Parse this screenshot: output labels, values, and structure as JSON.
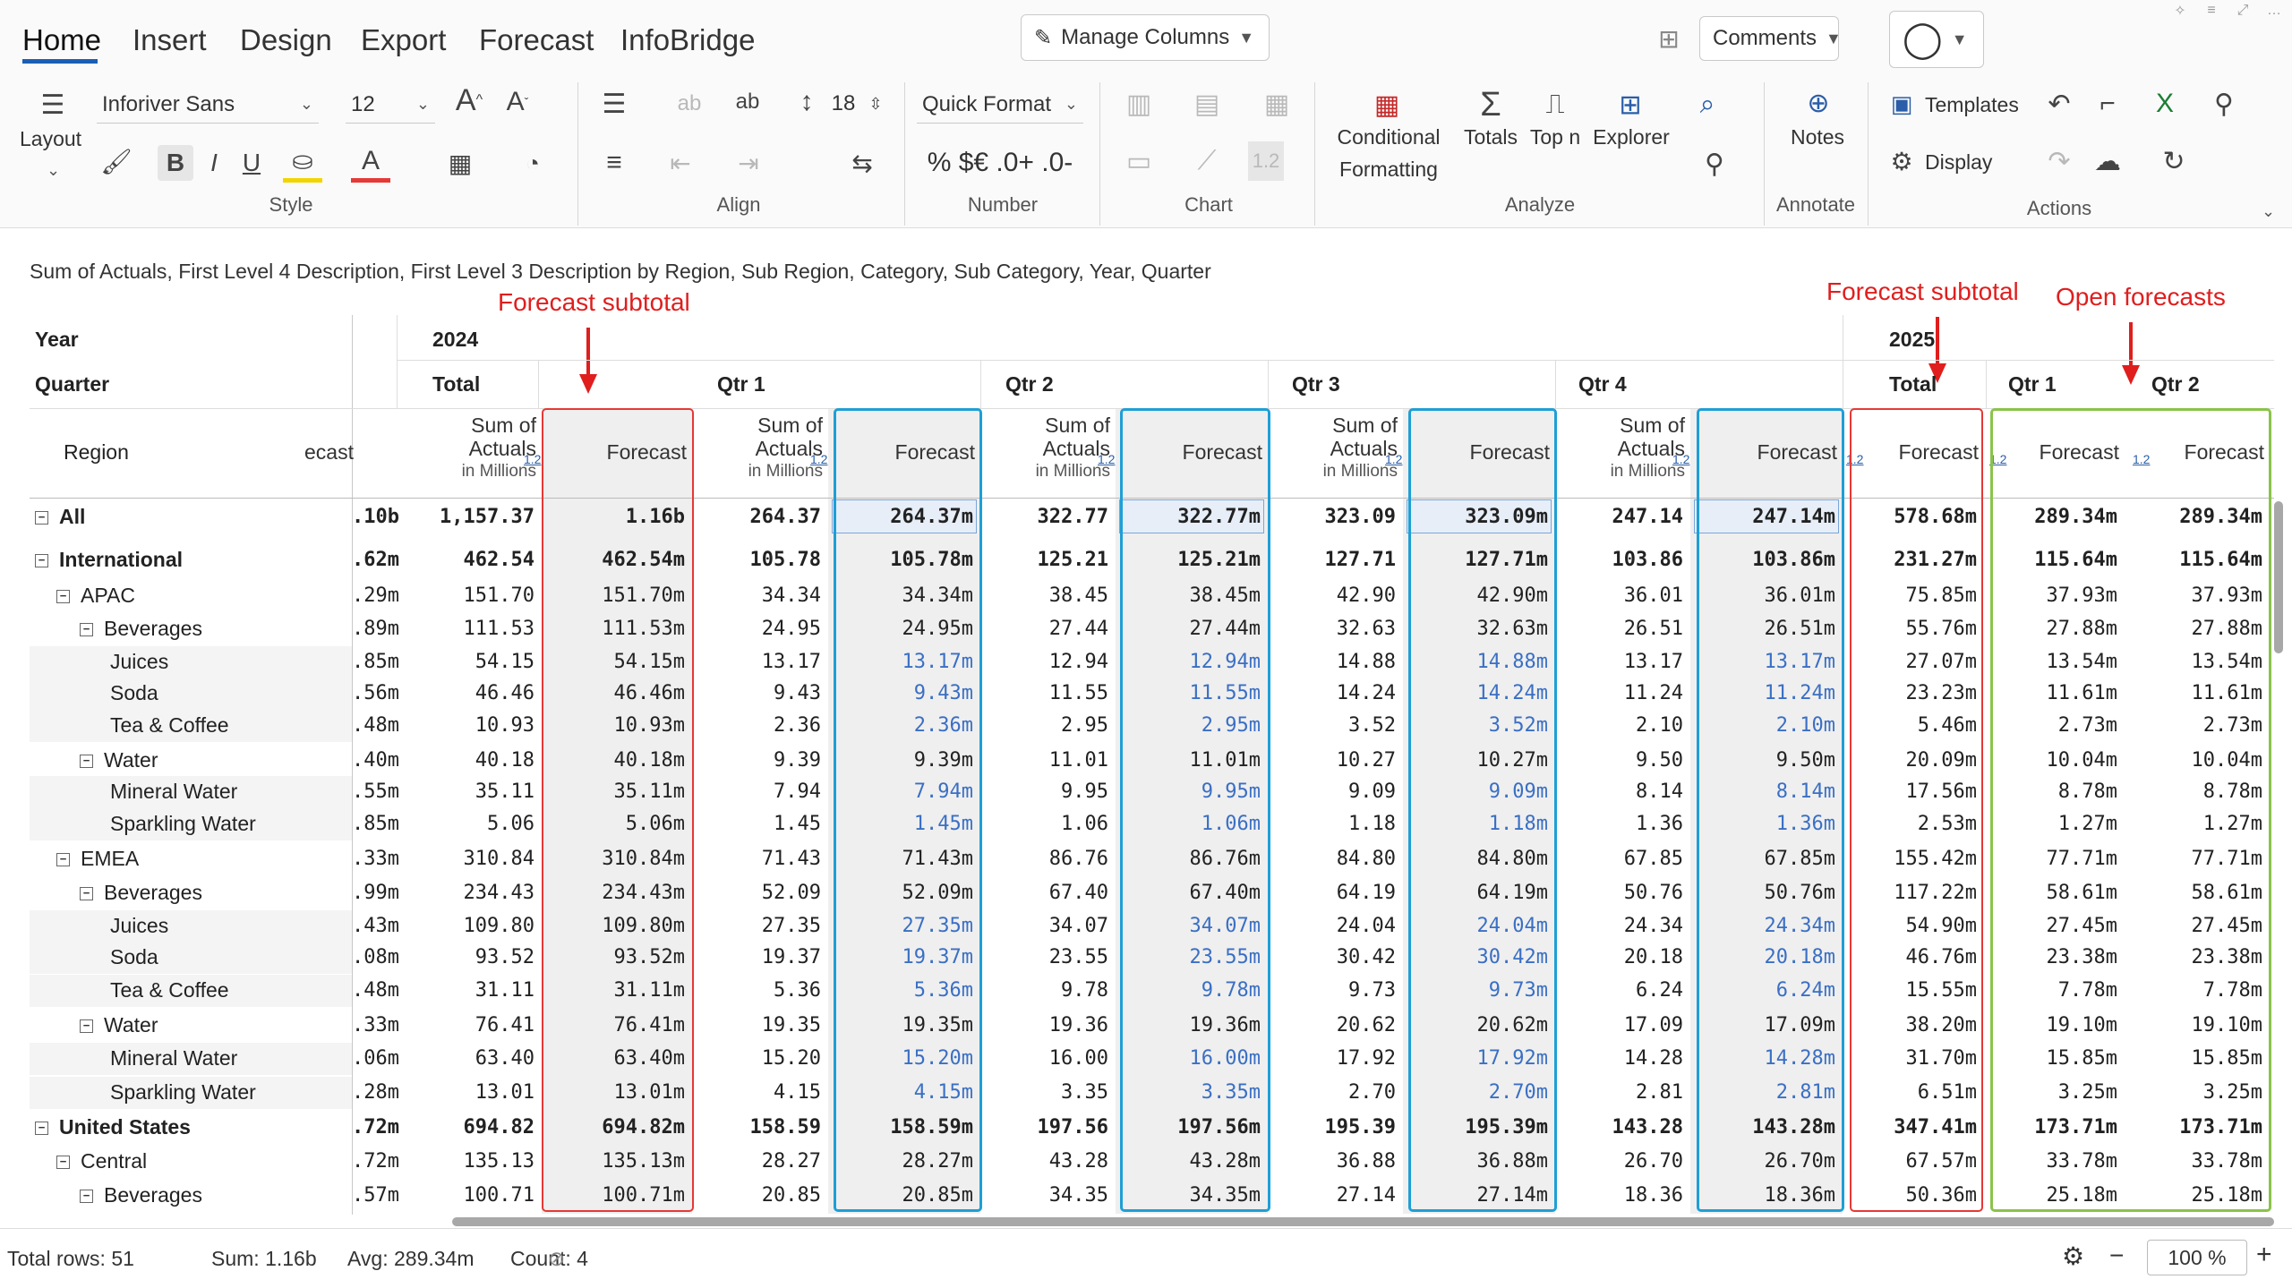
{
  "ribbon": {
    "tabs": [
      "Home",
      "Insert",
      "Design",
      "Export",
      "Forecast",
      "InfoBridge"
    ],
    "manage_columns": "Manage Columns",
    "comments": "Comments",
    "font_family": "Inforiver Sans",
    "font_size": "12",
    "row_height": "18",
    "number_format": "Quick Format",
    "layout_label": "Layout",
    "conditional_formatting_line1": "Conditional",
    "conditional_formatting_line2": "Formatting",
    "totals": "Totals",
    "top_n": "Top n",
    "explorer": "Explorer",
    "notes": "Notes",
    "templates": "Templates",
    "display": "Display",
    "number_icons": "% $€ .0+ .0-",
    "groups": {
      "style": "Style",
      "align": "Align",
      "number": "Number",
      "chart": "Chart",
      "analyze": "Analyze",
      "annotate": "Annotate",
      "actions": "Actions"
    },
    "icons": [
      "bullet-list-icon",
      "paint-brush-icon",
      "bold-icon",
      "italic-icon",
      "underline-icon",
      "fill-color-icon",
      "font-color-icon",
      "borders-icon",
      "visibility-icon",
      "align-icon",
      "indent-icon",
      "line-height-icon",
      "sigma-icon",
      "search-icon",
      "filter-icon",
      "undo-icon",
      "redo-icon",
      "excel-icon",
      "settings-icon",
      "user-icon"
    ]
  },
  "description": "Sum of Actuals, First Level 4 Description, First Level 3 Description by Region, Sub Region, Category, Sub Category, Year, Quarter",
  "annotations": {
    "forecast_subtotal_1": "Forecast subtotal",
    "forecast_subtotal_2": "Forecast subtotal",
    "open_forecasts": "Open forecasts"
  },
  "headers": {
    "year_label": "Year",
    "quarter_label": "Quarter",
    "region_label": "Region",
    "year_2024": "2024",
    "year_2025": "2025",
    "total": "Total",
    "total_2025": "Total",
    "q1": "Qtr 1",
    "q2": "Qtr 2",
    "q3": "Qtr 3",
    "q4": "Qtr 4",
    "q1_2025": "Qtr 1",
    "q2_2025": "Qtr 2",
    "partial_col": "ecast",
    "sum_of": "Sum of",
    "actuals": "Actuals",
    "in_millions": "in Millions",
    "forecast": "Forecast",
    "badge": "1.2"
  },
  "rows": [
    {
      "label": "All",
      "level": 0,
      "bold": true,
      "toggle": "−",
      "values": [
        ".10b",
        "1,157.37",
        "1.16b",
        "264.37",
        "264.37m",
        "322.77",
        "322.77m",
        "323.09",
        "323.09m",
        "247.14",
        "247.14m",
        "578.68m",
        "289.34m",
        "289.34m"
      ]
    },
    {
      "label": "International",
      "level": 0,
      "bold": true,
      "toggle": "−",
      "values": [
        ".62m",
        "462.54",
        "462.54m",
        "105.78",
        "105.78m",
        "125.21",
        "125.21m",
        "127.71",
        "127.71m",
        "103.86",
        "103.86m",
        "231.27m",
        "115.64m",
        "115.64m"
      ]
    },
    {
      "label": "APAC",
      "level": 1,
      "bold": false,
      "toggle": "−",
      "values": [
        ".29m",
        "151.70",
        "151.70m",
        "34.34",
        "34.34m",
        "38.45",
        "38.45m",
        "42.90",
        "42.90m",
        "36.01",
        "36.01m",
        "75.85m",
        "37.93m",
        "37.93m"
      ]
    },
    {
      "label": "Beverages",
      "level": 2,
      "bold": false,
      "toggle": "−",
      "values": [
        ".89m",
        "111.53",
        "111.53m",
        "24.95",
        "24.95m",
        "27.44",
        "27.44m",
        "32.63",
        "32.63m",
        "26.51",
        "26.51m",
        "55.76m",
        "27.88m",
        "27.88m"
      ]
    },
    {
      "label": "Juices",
      "level": 3,
      "bold": false,
      "toggle": "",
      "values": [
        ".85m",
        "54.15",
        "54.15m",
        "13.17",
        "13.17m",
        "12.94",
        "12.94m",
        "14.88",
        "14.88m",
        "13.17",
        "13.17m",
        "27.07m",
        "13.54m",
        "13.54m"
      ]
    },
    {
      "label": "Soda",
      "level": 3,
      "bold": false,
      "toggle": "",
      "values": [
        ".56m",
        "46.46",
        "46.46m",
        "9.43",
        "9.43m",
        "11.55",
        "11.55m",
        "14.24",
        "14.24m",
        "11.24",
        "11.24m",
        "23.23m",
        "11.61m",
        "11.61m"
      ]
    },
    {
      "label": "Tea & Coffee",
      "level": 3,
      "bold": false,
      "toggle": "",
      "values": [
        ".48m",
        "10.93",
        "10.93m",
        "2.36",
        "2.36m",
        "2.95",
        "2.95m",
        "3.52",
        "3.52m",
        "2.10",
        "2.10m",
        "5.46m",
        "2.73m",
        "2.73m"
      ]
    },
    {
      "label": "Water",
      "level": 2,
      "bold": false,
      "toggle": "−",
      "values": [
        ".40m",
        "40.18",
        "40.18m",
        "9.39",
        "9.39m",
        "11.01",
        "11.01m",
        "10.27",
        "10.27m",
        "9.50",
        "9.50m",
        "20.09m",
        "10.04m",
        "10.04m"
      ]
    },
    {
      "label": "Mineral Water",
      "level": 3,
      "bold": false,
      "toggle": "",
      "values": [
        ".55m",
        "35.11",
        "35.11m",
        "7.94",
        "7.94m",
        "9.95",
        "9.95m",
        "9.09",
        "9.09m",
        "8.14",
        "8.14m",
        "17.56m",
        "8.78m",
        "8.78m"
      ]
    },
    {
      "label": "Sparkling Water",
      "level": 3,
      "bold": false,
      "toggle": "",
      "values": [
        ".85m",
        "5.06",
        "5.06m",
        "1.45",
        "1.45m",
        "1.06",
        "1.06m",
        "1.18",
        "1.18m",
        "1.36",
        "1.36m",
        "2.53m",
        "1.27m",
        "1.27m"
      ]
    },
    {
      "label": "EMEA",
      "level": 1,
      "bold": false,
      "toggle": "−",
      "values": [
        ".33m",
        "310.84",
        "310.84m",
        "71.43",
        "71.43m",
        "86.76",
        "86.76m",
        "84.80",
        "84.80m",
        "67.85",
        "67.85m",
        "155.42m",
        "77.71m",
        "77.71m"
      ]
    },
    {
      "label": "Beverages",
      "level": 2,
      "bold": false,
      "toggle": "−",
      "values": [
        ".99m",
        "234.43",
        "234.43m",
        "52.09",
        "52.09m",
        "67.40",
        "67.40m",
        "64.19",
        "64.19m",
        "50.76",
        "50.76m",
        "117.22m",
        "58.61m",
        "58.61m"
      ]
    },
    {
      "label": "Juices",
      "level": 3,
      "bold": false,
      "toggle": "",
      "values": [
        ".43m",
        "109.80",
        "109.80m",
        "27.35",
        "27.35m",
        "34.07",
        "34.07m",
        "24.04",
        "24.04m",
        "24.34",
        "24.34m",
        "54.90m",
        "27.45m",
        "27.45m"
      ]
    },
    {
      "label": "Soda",
      "level": 3,
      "bold": false,
      "toggle": "",
      "values": [
        ".08m",
        "93.52",
        "93.52m",
        "19.37",
        "19.37m",
        "23.55",
        "23.55m",
        "30.42",
        "30.42m",
        "20.18",
        "20.18m",
        "46.76m",
        "23.38m",
        "23.38m"
      ]
    },
    {
      "label": "Tea & Coffee",
      "level": 3,
      "bold": false,
      "toggle": "",
      "values": [
        ".48m",
        "31.11",
        "31.11m",
        "5.36",
        "5.36m",
        "9.78",
        "9.78m",
        "9.73",
        "9.73m",
        "6.24",
        "6.24m",
        "15.55m",
        "7.78m",
        "7.78m"
      ]
    },
    {
      "label": "Water",
      "level": 2,
      "bold": false,
      "toggle": "−",
      "values": [
        ".33m",
        "76.41",
        "76.41m",
        "19.35",
        "19.35m",
        "19.36",
        "19.36m",
        "20.62",
        "20.62m",
        "17.09",
        "17.09m",
        "38.20m",
        "19.10m",
        "19.10m"
      ]
    },
    {
      "label": "Mineral Water",
      "level": 3,
      "bold": false,
      "toggle": "",
      "values": [
        ".06m",
        "63.40",
        "63.40m",
        "15.20",
        "15.20m",
        "16.00",
        "16.00m",
        "17.92",
        "17.92m",
        "14.28",
        "14.28m",
        "31.70m",
        "15.85m",
        "15.85m"
      ]
    },
    {
      "label": "Sparkling Water",
      "level": 3,
      "bold": false,
      "toggle": "",
      "values": [
        ".28m",
        "13.01",
        "13.01m",
        "4.15",
        "4.15m",
        "3.35",
        "3.35m",
        "2.70",
        "2.70m",
        "2.81",
        "2.81m",
        "6.51m",
        "3.25m",
        "3.25m"
      ]
    },
    {
      "label": "United States",
      "level": 0,
      "bold": true,
      "toggle": "−",
      "values": [
        ".72m",
        "694.82",
        "694.82m",
        "158.59",
        "158.59m",
        "197.56",
        "197.56m",
        "195.39",
        "195.39m",
        "143.28",
        "143.28m",
        "347.41m",
        "173.71m",
        "173.71m"
      ]
    },
    {
      "label": "Central",
      "level": 1,
      "bold": false,
      "toggle": "−",
      "values": [
        ".72m",
        "135.13",
        "135.13m",
        "28.27",
        "28.27m",
        "43.28",
        "43.28m",
        "36.88",
        "36.88m",
        "26.70",
        "26.70m",
        "67.57m",
        "33.78m",
        "33.78m"
      ]
    },
    {
      "label": "Beverages",
      "level": 2,
      "bold": false,
      "toggle": "−",
      "values": [
        ".57m",
        "100.71",
        "100.71m",
        "20.85",
        "20.85m",
        "34.35",
        "34.35m",
        "27.14",
        "27.14m",
        "18.36",
        "18.36m",
        "50.36m",
        "25.18m",
        "25.18m"
      ]
    }
  ],
  "status": {
    "total_rows": "Total rows: 51",
    "sum": "Sum: 1.16b",
    "avg": "Avg: 289.34m",
    "count": "Count: 4",
    "zoom": "100 %"
  }
}
